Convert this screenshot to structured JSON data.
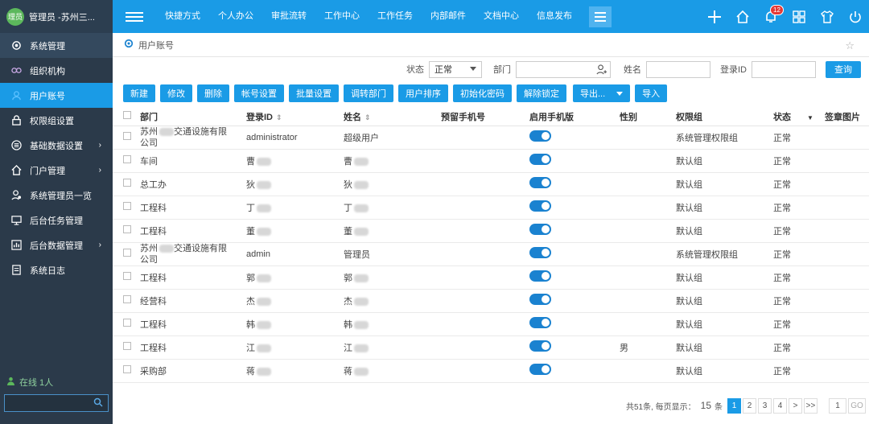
{
  "topbar": {
    "avatar_text": "理员",
    "user_label": "管理员 -苏州三...",
    "nav": [
      "快捷方式",
      "个人办公",
      "审批流转",
      "工作中心",
      "工作任务",
      "内部邮件",
      "文档中心",
      "信息发布"
    ],
    "notification_count": "12"
  },
  "sidebar": {
    "items": [
      {
        "label": "系统管理",
        "icon": "gear-icon"
      },
      {
        "label": "组织机构",
        "icon": "org-icon"
      },
      {
        "label": "用户账号",
        "icon": "user-icon"
      },
      {
        "label": "权限组设置",
        "icon": "lock-icon"
      },
      {
        "label": "基础数据设置",
        "icon": "list-icon"
      },
      {
        "label": "门户管理",
        "icon": "home-icon"
      },
      {
        "label": "系统管理员一览",
        "icon": "admin-icon"
      },
      {
        "label": "后台任务管理",
        "icon": "monitor-icon"
      },
      {
        "label": "后台数据管理",
        "icon": "chart-icon"
      },
      {
        "label": "系统日志",
        "icon": "doc-icon"
      }
    ],
    "online": "在线 1人"
  },
  "breadcrumb": "用户账号",
  "filters": {
    "status_label": "状态",
    "status_value": "正常",
    "dept_label": "部门",
    "name_label": "姓名",
    "login_label": "登录ID",
    "query_label": "查询"
  },
  "toolbar": [
    "新建",
    "修改",
    "删除",
    "帐号设置",
    "批量设置",
    "调转部门",
    "用户排序",
    "初始化密码",
    "解除锁定",
    "导出...",
    "导入"
  ],
  "table": {
    "headers": [
      "部门",
      "登录ID",
      "姓名",
      "预留手机号",
      "启用手机版",
      "性别",
      "权限组",
      "状态",
      "签章图片"
    ],
    "rows": [
      {
        "dept": "苏州",
        "dept_rest": "交通设施有限",
        "dept_line2": "公司",
        "login": "administrator",
        "name": "超级用户",
        "gender": "",
        "group": "系统管理权限组",
        "status": "正常"
      },
      {
        "dept": "车间",
        "login": "曹",
        "name": "曹",
        "gender": "",
        "group": "默认组",
        "status": "正常"
      },
      {
        "dept": "总工办",
        "login": "狄",
        "name": "狄",
        "gender": "",
        "group": "默认组",
        "status": "正常"
      },
      {
        "dept": "工程科",
        "login": "丁",
        "name": "丁",
        "gender": "",
        "group": "默认组",
        "status": "正常"
      },
      {
        "dept": "工程科",
        "login": "董",
        "name": "董",
        "gender": "",
        "group": "默认组",
        "status": "正常"
      },
      {
        "dept": "苏州",
        "dept_rest": "交通设施有限",
        "dept_line2": "公司",
        "login": "admin",
        "name": "管理员",
        "gender": "",
        "group": "系统管理权限组",
        "status": "正常"
      },
      {
        "dept": "工程科",
        "login": "郭",
        "name": "郭",
        "gender": "",
        "group": "默认组",
        "status": "正常"
      },
      {
        "dept": "经营科",
        "login": "杰",
        "name": "杰",
        "gender": "",
        "group": "默认组",
        "status": "正常"
      },
      {
        "dept": "工程科",
        "login": "韩",
        "name": "韩",
        "gender": "",
        "group": "默认组",
        "status": "正常"
      },
      {
        "dept": "工程科",
        "login": "江",
        "name": "江",
        "gender": "男",
        "group": "默认组",
        "status": "正常"
      },
      {
        "dept": "采购部",
        "login": "蒋",
        "name": "蒋",
        "gender": "",
        "group": "默认组",
        "status": "正常"
      }
    ]
  },
  "pager": {
    "summary": "共51条, 每页显示：",
    "page_size": "15",
    "unit": "条",
    "pages": [
      "1",
      "2",
      "3",
      "4"
    ],
    "next": ">",
    "last": ">>",
    "goto_value": "1",
    "go_label": "GO"
  }
}
